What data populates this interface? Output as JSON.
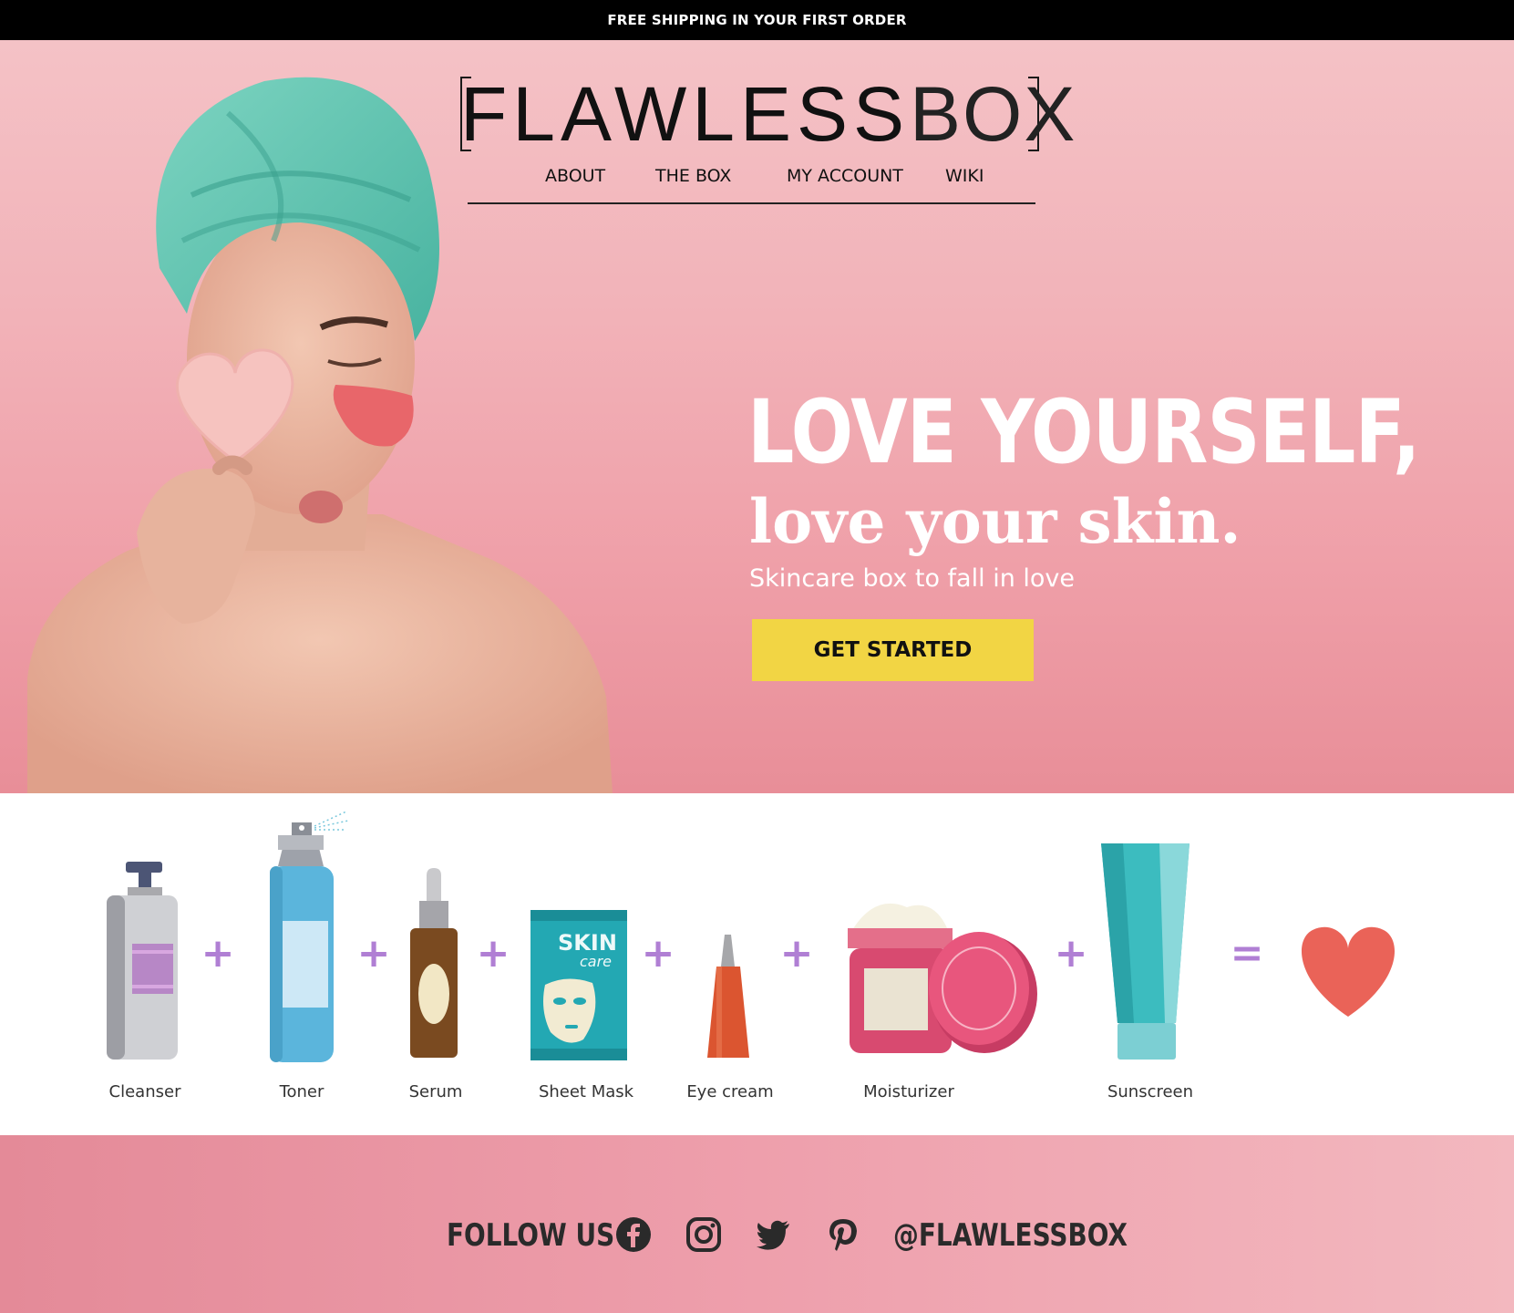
{
  "announcement": "FREE SHIPPING IN YOUR FIRST ORDER",
  "logo": {
    "part1": "FLAWLESS",
    "part2": "BOX"
  },
  "nav": [
    {
      "label": "ABOUT"
    },
    {
      "label": "THE BOX"
    },
    {
      "label": "MY ACCOUNT"
    },
    {
      "label": "WIKI"
    }
  ],
  "hero": {
    "headline": "LOVE YOURSELF,",
    "subheadline": "love your skin.",
    "tagline": "Skincare box to fall in love",
    "cta_label": "GET STARTED"
  },
  "routine": {
    "steps": [
      {
        "label": "Cleanser",
        "icon": "pump-bottle-icon"
      },
      {
        "label": "Toner",
        "icon": "spray-bottle-icon"
      },
      {
        "label": "Serum",
        "icon": "dropper-bottle-icon"
      },
      {
        "label": "Sheet Mask",
        "icon": "sheet-mask-icon",
        "pack_text_1": "SKIN",
        "pack_text_2": "care"
      },
      {
        "label": "Eye cream",
        "icon": "tube-icon"
      },
      {
        "label": "Moisturizer",
        "icon": "cream-jar-icon"
      },
      {
        "label": "Sunscreen",
        "icon": "squeeze-tube-icon"
      }
    ],
    "plus": "+",
    "equals": "=",
    "result_icon": "heart-icon"
  },
  "footer": {
    "follow_label": "FOLLOW US",
    "handle": "@FLAWLESSBOX",
    "social": [
      "facebook-icon",
      "instagram-icon",
      "twitter-icon",
      "pinterest-icon"
    ]
  },
  "colors": {
    "accent": "#f2d544",
    "operator": "#b07fd4",
    "heart": "#ea6358"
  }
}
